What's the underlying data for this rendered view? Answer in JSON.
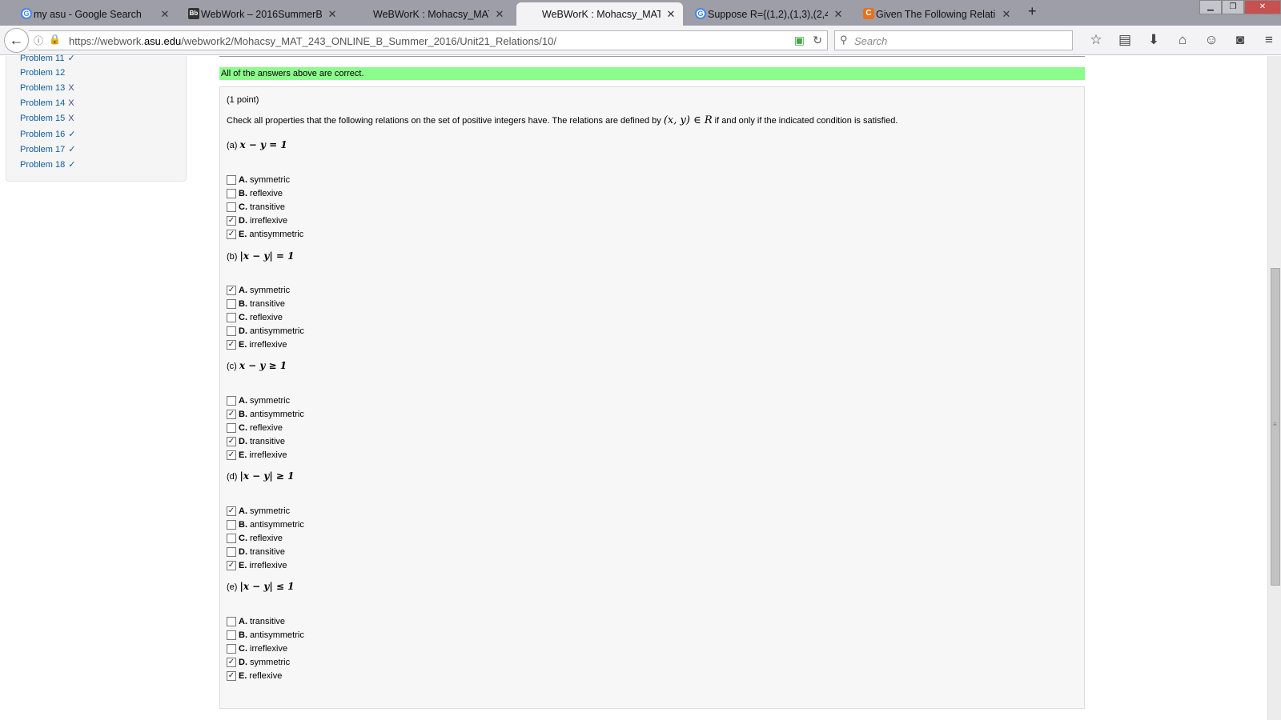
{
  "browser": {
    "tabs": [
      {
        "title": "my asu - Google Search",
        "favicon": "google-icon",
        "active": false
      },
      {
        "title": "WebWork – 2016SummerB...",
        "favicon": "blackboard-icon",
        "active": false
      },
      {
        "title": "WeBWorK : Mohacsy_MAT...",
        "favicon": "",
        "active": false
      },
      {
        "title": "WeBWorK : Mohacsy_MAT...",
        "favicon": "",
        "active": true
      },
      {
        "title": "Suppose R={(1,2),(1,3),(2,4)...",
        "favicon": "google-icon",
        "active": false
      },
      {
        "title": "Given The Following Relati...",
        "favicon": "chegg-icon",
        "active": false
      }
    ],
    "new_tab": "+",
    "url_prefix": "https://webwork.",
    "url_domain": "asu.edu",
    "url_path": "/webwork2/Mohacsy_MAT_243_ONLINE_B_Summer_2016/Unit21_Relations/10/",
    "search_placeholder": "Search"
  },
  "sidebar": {
    "items": [
      {
        "label": "Problem 11",
        "status": "✓"
      },
      {
        "label": "Problem 12",
        "status": ""
      },
      {
        "label": "Problem 13",
        "status": "X"
      },
      {
        "label": "Problem 14",
        "status": "X"
      },
      {
        "label": "Problem 15",
        "status": "X"
      },
      {
        "label": "Problem 16",
        "status": "✓"
      },
      {
        "label": "Problem 17",
        "status": "✓"
      },
      {
        "label": "Problem 18",
        "status": "✓"
      }
    ]
  },
  "banner": "All of the answers above are correct.",
  "problem": {
    "points": "(1 point)",
    "intro_before": "Check all properties that the following relations on the set of positive integers have. The relations are defined by",
    "intro_math": "(x, y) ∈ R",
    "intro_after": "if and only if the indicated condition is satisfied.",
    "parts": [
      {
        "label": "(a)",
        "math": "x − y = 1",
        "options": [
          {
            "letter": "A.",
            "text": "symmetric",
            "checked": false
          },
          {
            "letter": "B.",
            "text": "reflexive",
            "checked": false
          },
          {
            "letter": "C.",
            "text": "transitive",
            "checked": false
          },
          {
            "letter": "D.",
            "text": "irreflexive",
            "checked": true
          },
          {
            "letter": "E.",
            "text": "antisymmetric",
            "checked": true
          }
        ]
      },
      {
        "label": "(b)",
        "math": "|x − y| = 1",
        "options": [
          {
            "letter": "A.",
            "text": "symmetric",
            "checked": true
          },
          {
            "letter": "B.",
            "text": "transitive",
            "checked": false
          },
          {
            "letter": "C.",
            "text": "reflexive",
            "checked": false
          },
          {
            "letter": "D.",
            "text": "antisymmetric",
            "checked": false
          },
          {
            "letter": "E.",
            "text": "irreflexive",
            "checked": true
          }
        ]
      },
      {
        "label": "(c)",
        "math": "x − y ≥ 1",
        "options": [
          {
            "letter": "A.",
            "text": "symmetric",
            "checked": false
          },
          {
            "letter": "B.",
            "text": "antisymmetric",
            "checked": true
          },
          {
            "letter": "C.",
            "text": "reflexive",
            "checked": false
          },
          {
            "letter": "D.",
            "text": "transitive",
            "checked": true
          },
          {
            "letter": "E.",
            "text": "irreflexive",
            "checked": true
          }
        ]
      },
      {
        "label": "(d)",
        "math": "|x − y| ≥ 1",
        "options": [
          {
            "letter": "A.",
            "text": "symmetric",
            "checked": true
          },
          {
            "letter": "B.",
            "text": "antisymmetric",
            "checked": false
          },
          {
            "letter": "C.",
            "text": "reflexive",
            "checked": false
          },
          {
            "letter": "D.",
            "text": "transitive",
            "checked": false
          },
          {
            "letter": "E.",
            "text": "irreflexive",
            "checked": true
          }
        ]
      },
      {
        "label": "(e)",
        "math": "|x − y| ≤ 1",
        "options": [
          {
            "letter": "A.",
            "text": "transitive",
            "checked": false
          },
          {
            "letter": "B.",
            "text": "antisymmetric",
            "checked": false
          },
          {
            "letter": "C.",
            "text": "irreflexive",
            "checked": false
          },
          {
            "letter": "D.",
            "text": "symmetric",
            "checked": true
          },
          {
            "letter": "E.",
            "text": "reflexive",
            "checked": true
          }
        ]
      }
    ]
  },
  "colors": {
    "banner_bg": "#8cfc8c",
    "link": "#0f5ea0"
  }
}
